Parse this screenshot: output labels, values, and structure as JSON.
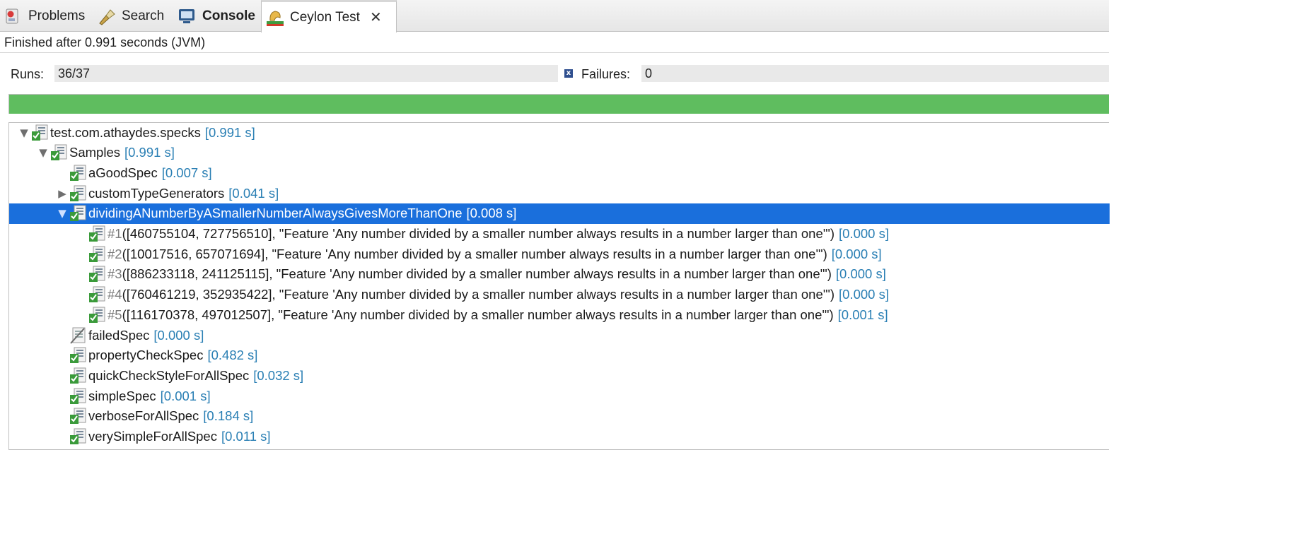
{
  "tabs": [
    {
      "label": "Problems",
      "icon": "problems-icon",
      "bold": false
    },
    {
      "label": "Search",
      "icon": "search-flashlight-icon",
      "bold": false
    },
    {
      "label": "Console",
      "icon": "console-icon",
      "bold": true
    },
    {
      "label": "Ceylon Test",
      "icon": "ceylon-test-icon",
      "bold": false,
      "active": true
    }
  ],
  "status": "Finished after 0.991 seconds (JVM)",
  "counters": {
    "runs_label": "Runs:",
    "runs_value": "36/37",
    "failures_label": "Failures:",
    "failures_value": "0"
  },
  "progress": {
    "fraction": 1.0,
    "color": "#5fbd5f"
  },
  "colors": {
    "selection": "#1a6fdc",
    "duration": "#2a7fb4"
  },
  "tree": [
    {
      "level": 0,
      "expander": "expanded",
      "icon": "test-suite-passed-icon",
      "name": "test.com.athaydes.specks",
      "duration": "[0.991 s]"
    },
    {
      "level": 1,
      "expander": "expanded",
      "icon": "test-suite-passed-icon",
      "name": "Samples",
      "duration": "[0.991 s]"
    },
    {
      "level": 2,
      "expander": "none",
      "icon": "test-passed-icon",
      "name": "aGoodSpec",
      "duration": "[0.007 s]"
    },
    {
      "level": 2,
      "expander": "collapsed",
      "icon": "test-passed-icon",
      "name": "customTypeGenerators",
      "duration": "[0.041 s]"
    },
    {
      "level": 2,
      "expander": "expanded",
      "icon": "test-passed-icon",
      "name": "dividingANumberByASmallerNumberAlwaysGivesMoreThanOne",
      "duration": "[0.008 s]",
      "selected": true
    },
    {
      "level": 3,
      "expander": "none",
      "icon": "test-passed-icon",
      "num": "#1",
      "name": " ([460755104, 727756510], \"Feature 'Any number divided by a smaller number always results in a number larger than one'\")",
      "duration": "[0.000 s]"
    },
    {
      "level": 3,
      "expander": "none",
      "icon": "test-passed-icon",
      "num": "#2",
      "name": " ([10017516, 657071694], \"Feature 'Any number divided by a smaller number always results in a number larger than one'\")",
      "duration": "[0.000 s]"
    },
    {
      "level": 3,
      "expander": "none",
      "icon": "test-passed-icon",
      "num": "#3",
      "name": " ([886233118, 241125115], \"Feature 'Any number divided by a smaller number always results in a number larger than one'\")",
      "duration": "[0.000 s]"
    },
    {
      "level": 3,
      "expander": "none",
      "icon": "test-passed-icon",
      "num": "#4",
      "name": " ([760461219, 352935422], \"Feature 'Any number divided by a smaller number always results in a number larger than one'\")",
      "duration": "[0.000 s]"
    },
    {
      "level": 3,
      "expander": "none",
      "icon": "test-passed-icon",
      "num": "#5",
      "name": " ([116170378, 497012507], \"Feature 'Any number divided by a smaller number always results in a number larger than one'\")",
      "duration": "[0.001 s]"
    },
    {
      "level": 2,
      "expander": "none",
      "icon": "test-ignored-icon",
      "name": "failedSpec",
      "duration": "[0.000 s]"
    },
    {
      "level": 2,
      "expander": "none",
      "icon": "test-passed-icon",
      "name": "propertyCheckSpec",
      "duration": "[0.482 s]"
    },
    {
      "level": 2,
      "expander": "none",
      "icon": "test-passed-icon",
      "name": "quickCheckStyleForAllSpec",
      "duration": "[0.032 s]"
    },
    {
      "level": 2,
      "expander": "none",
      "icon": "test-passed-icon",
      "name": "simpleSpec",
      "duration": "[0.001 s]"
    },
    {
      "level": 2,
      "expander": "none",
      "icon": "test-passed-icon",
      "name": "verboseForAllSpec",
      "duration": "[0.184 s]"
    },
    {
      "level": 2,
      "expander": "none",
      "icon": "test-passed-icon",
      "name": "verySimpleForAllSpec",
      "duration": "[0.011 s]"
    }
  ]
}
